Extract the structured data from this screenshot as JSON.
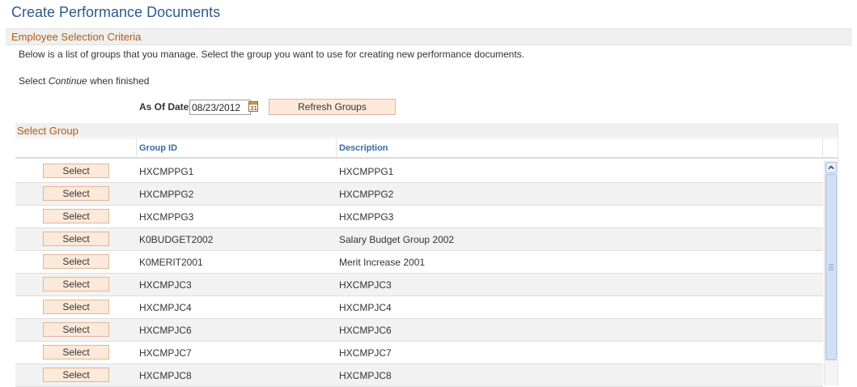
{
  "page": {
    "title": "Create Performance Documents"
  },
  "section": {
    "title": "Employee Selection Criteria",
    "intro": "Below is a list of groups that you manage. Select the group you want to use for creating new performance documents.",
    "instruction_prefix": "Select ",
    "instruction_em": "Continue",
    "instruction_suffix": " when finished"
  },
  "as_of": {
    "label": "As Of Date",
    "value": "08/23/2012",
    "calendar_icon": "calendar-icon"
  },
  "refresh_button": {
    "label": "Refresh Groups"
  },
  "group_grid": {
    "title": "Select Group",
    "columns": [
      "Group ID",
      "Description"
    ],
    "select_label": "Select",
    "rows": [
      {
        "group_id": "HXCMPPG1",
        "description": "HXCMPPG1"
      },
      {
        "group_id": "HXCMPPG2",
        "description": "HXCMPPG2"
      },
      {
        "group_id": "HXCMPPG3",
        "description": "HXCMPPG3"
      },
      {
        "group_id": "K0BUDGET2002",
        "description": "Salary Budget Group 2002"
      },
      {
        "group_id": "K0MERIT2001",
        "description": "Merit Increase 2001"
      },
      {
        "group_id": "HXCMPJC3",
        "description": "HXCMPJC3"
      },
      {
        "group_id": "HXCMPJC4",
        "description": "HXCMPJC4"
      },
      {
        "group_id": "HXCMPJC6",
        "description": "HXCMPJC6"
      },
      {
        "group_id": "HXCMPJC7",
        "description": "HXCMPJC7"
      },
      {
        "group_id": "HXCMPJC8",
        "description": "HXCMPJC8"
      }
    ]
  },
  "colors": {
    "title": "#2f5a8a",
    "section_title": "#b15d12",
    "button_bg": "#fce9d9",
    "button_border": "#e2b49a",
    "column_header": "#3a6aa0"
  }
}
